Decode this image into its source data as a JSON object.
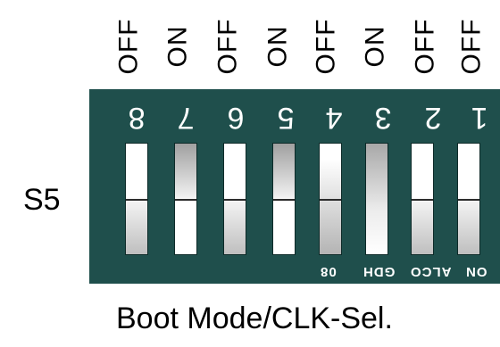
{
  "switch_states": [
    "OFF",
    "ON",
    "OFF",
    "ON",
    "OFF",
    "ON",
    "OFF",
    "OFF"
  ],
  "switch_numbers": [
    "8",
    "7",
    "6",
    "5",
    "4",
    "3",
    "2",
    "1"
  ],
  "bottom_labels": {
    "pos4": "08",
    "pos3": "GDH",
    "pos2": "ALCO",
    "pos1": "ON"
  },
  "side_label": "S5",
  "caption": "Boot Mode/CLK-Sel."
}
